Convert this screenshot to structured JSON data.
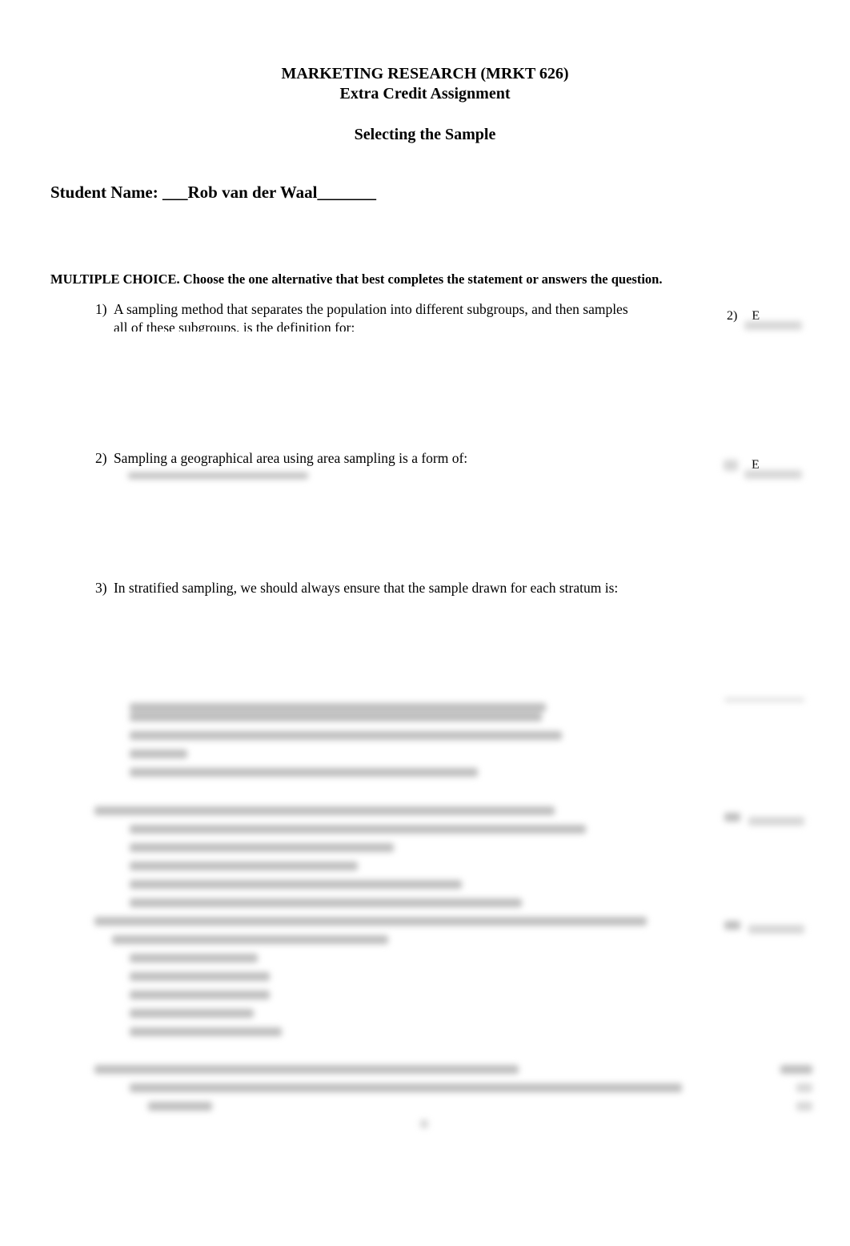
{
  "header": {
    "course": "MARKETING RESEARCH (MRKT 626)",
    "assignment": "Extra Credit Assignment",
    "topic": "Selecting the Sample"
  },
  "student": {
    "label": "Student Name: ",
    "value": "___Rob van der Waal_______"
  },
  "instructions": "MULTIPLE CHOICE.  Choose the one alternative that best completes the statement or answers the question.",
  "questions": [
    {
      "number": "1)",
      "text_line1": "A sampling method that separates the population into different subgroups, and then samples",
      "text_line2": "all of these subgroups, is the definition for:",
      "answer_number": "2)",
      "answer": "E"
    },
    {
      "number": "2)",
      "text_line1": "Sampling a geographical area using area sampling is a form of:",
      "answer": "E"
    },
    {
      "number": "3)",
      "text_line1": "In stratified sampling, we should always ensure that the sample drawn for each stratum is:"
    }
  ]
}
